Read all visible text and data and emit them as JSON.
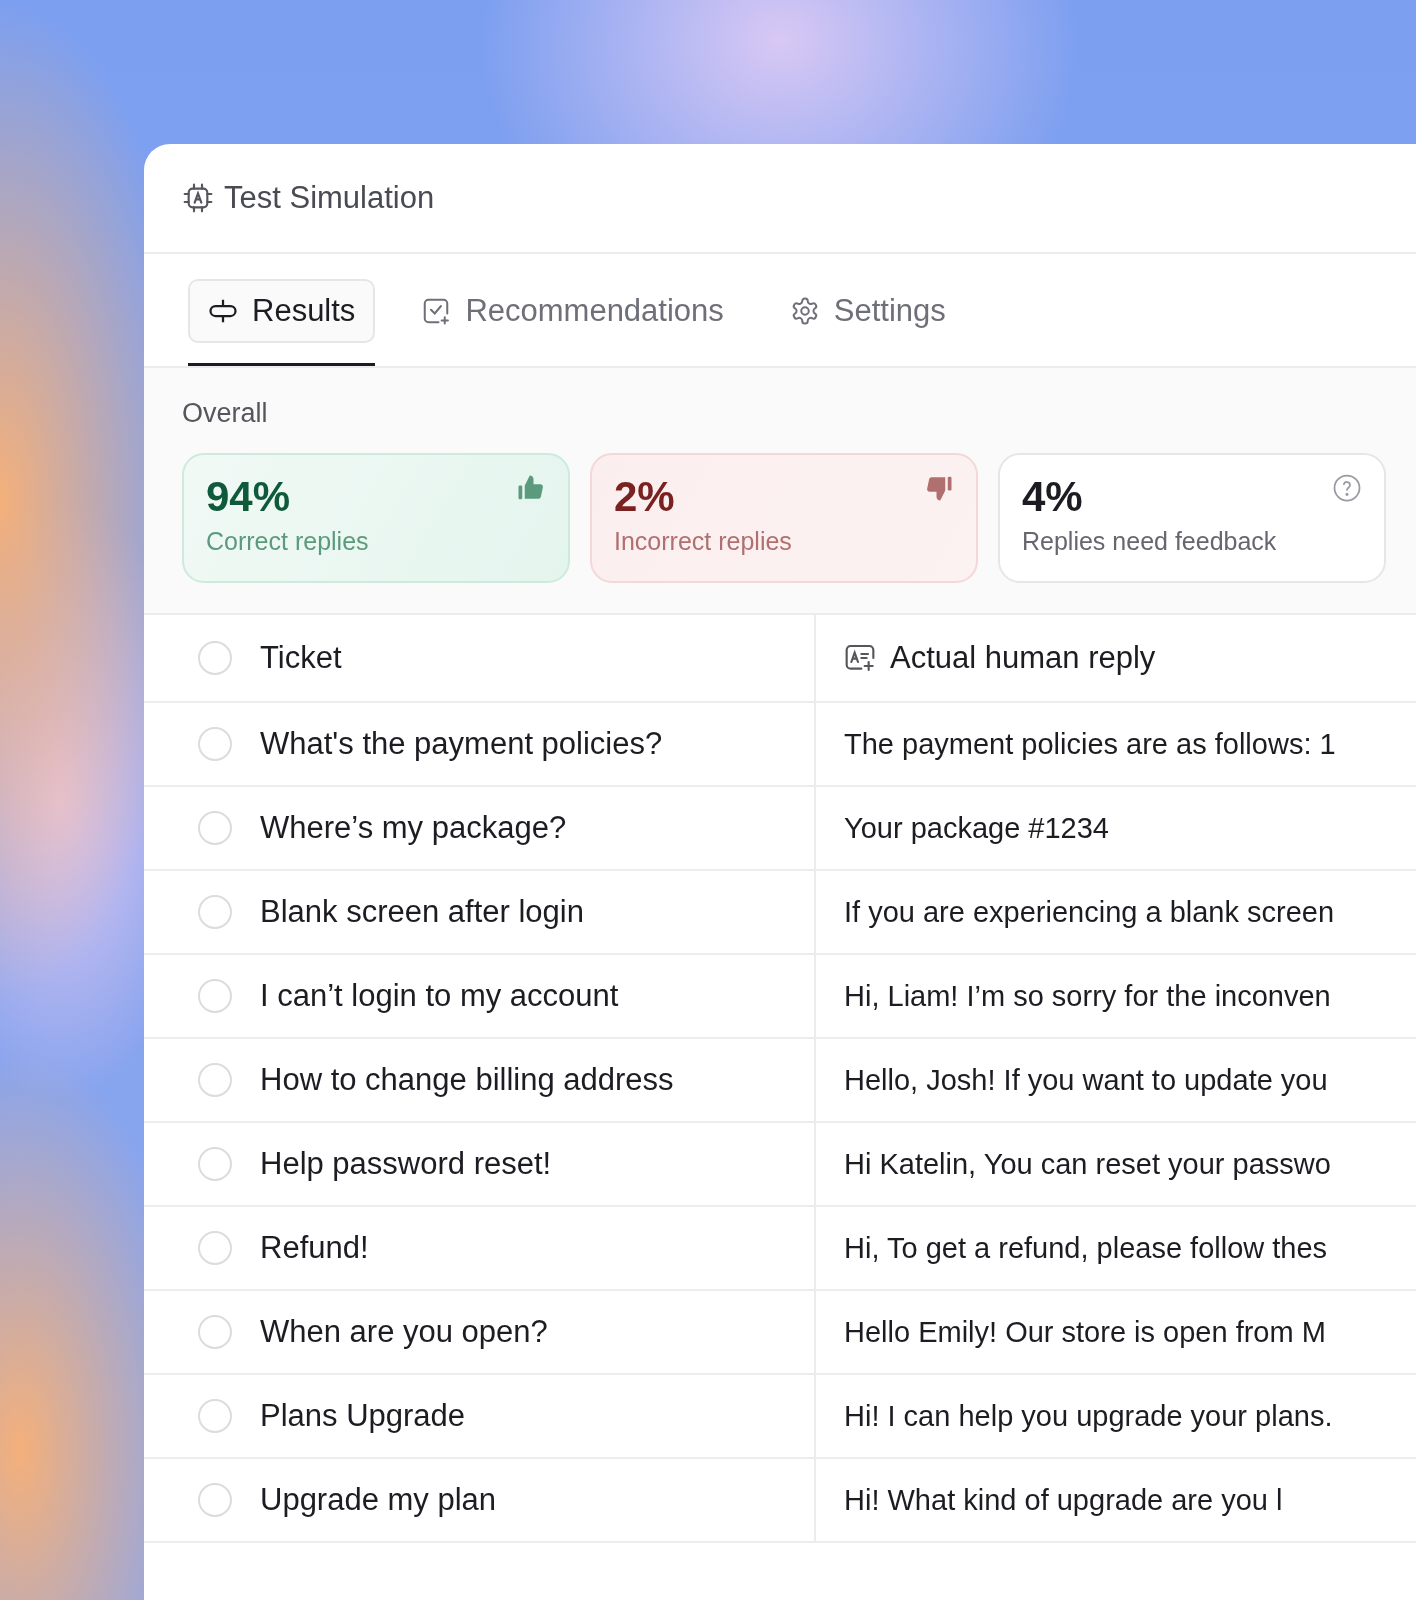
{
  "window": {
    "title": "Test Simulation"
  },
  "tabs": [
    {
      "label": "Results",
      "selected": true
    },
    {
      "label": "Recommendations",
      "selected": false
    },
    {
      "label": "Settings",
      "selected": false
    }
  ],
  "overall": {
    "label": "Overall",
    "cards": [
      {
        "kind": "correct",
        "value": "94%",
        "caption": "Correct replies"
      },
      {
        "kind": "incorrect",
        "value": "2%",
        "caption": "Incorrect replies"
      },
      {
        "kind": "feedback",
        "value": "4%",
        "caption": "Replies need feedback"
      }
    ]
  },
  "table": {
    "columns": [
      {
        "label": "Ticket"
      },
      {
        "label": "Actual human reply"
      }
    ],
    "header_checked": false,
    "rows": [
      {
        "checked": false,
        "ticket": "What's the payment policies?",
        "reply": "The payment policies are as follows: 1"
      },
      {
        "checked": false,
        "ticket": "Where’s my package?",
        "reply": "Your package #1234"
      },
      {
        "checked": false,
        "ticket": "Blank screen after login",
        "reply": "If you are experiencing a blank screen"
      },
      {
        "checked": false,
        "ticket": "I can’t login to my account",
        "reply": "Hi, Liam! I’m so sorry for the inconven"
      },
      {
        "checked": false,
        "ticket": "How to change billing address",
        "reply": "Hello, Josh! If you want to update you"
      },
      {
        "checked": false,
        "ticket": "Help password reset!",
        "reply": "Hi Katelin, You can reset your passwo"
      },
      {
        "checked": false,
        "ticket": "Refund!",
        "reply": "Hi, To get a refund, please follow thes"
      },
      {
        "checked": false,
        "ticket": "When are you open?",
        "reply": "Hello Emily! Our store is open from M"
      },
      {
        "checked": false,
        "ticket": "Plans Upgrade",
        "reply": "Hi! I can help you upgrade your plans."
      },
      {
        "checked": false,
        "ticket": "Upgrade my plan",
        "reply": "Hi! What kind of upgrade are you l"
      }
    ]
  }
}
